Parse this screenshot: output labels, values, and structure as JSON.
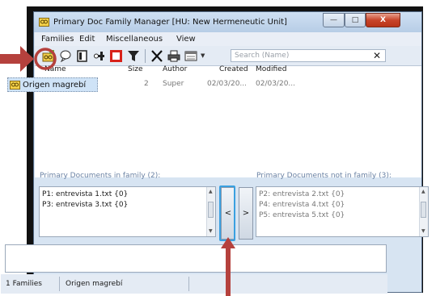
{
  "window": {
    "title": "Primary Doc Family Manager [HU: New Hermeneutic Unit]",
    "min_label": "—",
    "max_label": "□",
    "close_label": "X"
  },
  "menu": [
    "Families",
    "Edit",
    "Miscellaneous",
    "View"
  ],
  "toolbar": {
    "icons": [
      "new-family-icon",
      "comment-icon",
      "open-icon",
      "link-icon",
      "stop-icon",
      "filter-icon",
      "delete-icon",
      "print-icon",
      "view-icon"
    ],
    "search_placeholder": "Search (Name)",
    "search_clear": "✕"
  },
  "table": {
    "columns": [
      "Name",
      "Size",
      "Author",
      "Created",
      "Modified"
    ],
    "rows": [
      {
        "name": "Origen magrebí",
        "size": "2",
        "author": "Super",
        "created": "02/03/20...",
        "modified": "02/03/20..."
      }
    ]
  },
  "in_family": {
    "label": "Primary Documents in family (2):",
    "items": [
      "P1: entrevista 1.txt {0}",
      "P3: entrevista 3.txt {0}"
    ]
  },
  "not_in_family": {
    "label": "Primary Documents not in family (3):",
    "items": [
      "P2: entrevista 2.txt {0}",
      "P4: entrevista 4.txt {0}",
      "P5: entrevista 5.txt {0}"
    ]
  },
  "move_buttons": {
    "remove": "<",
    "add": ">"
  },
  "status": {
    "count": "1 Families",
    "current": "Origen magrebí"
  },
  "colors": {
    "annotation_red": "#b5413d",
    "highlight_blue": "#3aa0e0",
    "accent_label": "#6a82a4"
  }
}
